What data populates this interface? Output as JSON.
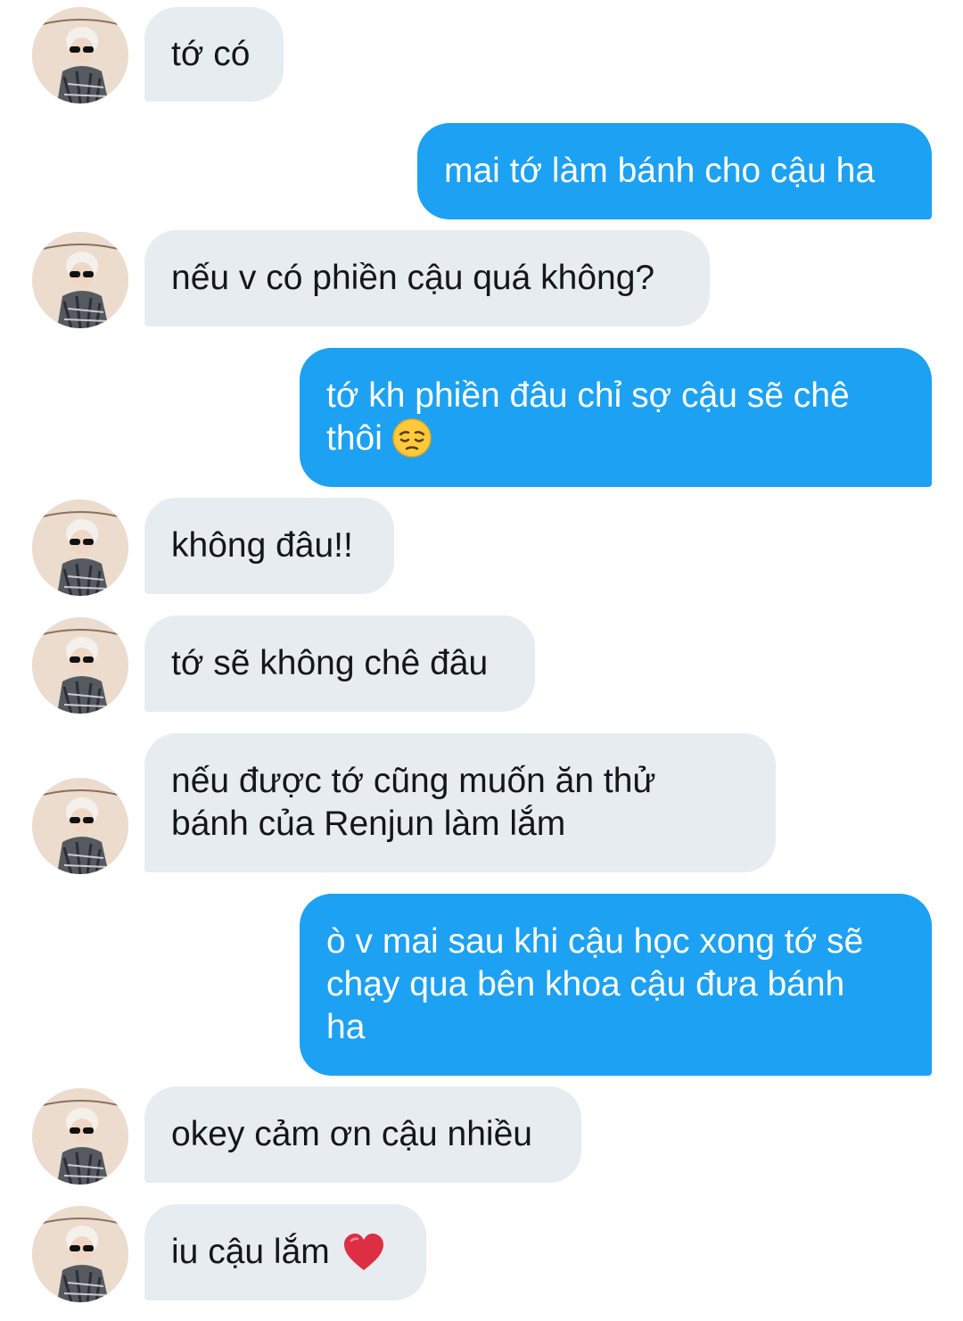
{
  "conversation": {
    "messages": [
      {
        "side": "in",
        "text": "tớ có"
      },
      {
        "side": "out",
        "text": "mai tớ làm bánh cho cậu ha"
      },
      {
        "side": "in",
        "text": "nếu v có phiền cậu quá không?"
      },
      {
        "side": "out",
        "text": "tớ kh phiền đâu chỉ sợ cậu sẽ chê\nthôi",
        "emoji": "pensive-face"
      },
      {
        "side": "in",
        "text": "không đâu!!"
      },
      {
        "side": "in",
        "text": "tớ sẽ không chê đâu"
      },
      {
        "side": "in",
        "text": "nếu được tớ cũng muốn ăn thử\nbánh của Renjun làm lắm"
      },
      {
        "side": "out",
        "text": "ò v mai sau khi cậu học xong tớ sẽ\nchạy qua bên khoa cậu đưa bánh\nha"
      },
      {
        "side": "in",
        "text": "okey cảm ơn cậu nhiều"
      },
      {
        "side": "in",
        "text": "iu cậu lắm",
        "emoji": "red-heart"
      }
    ]
  },
  "colors": {
    "incoming_bubble": "#e6ecf0",
    "outgoing_bubble": "#1da1f2",
    "incoming_text": "#14171a",
    "outgoing_text": "#ffffff"
  }
}
